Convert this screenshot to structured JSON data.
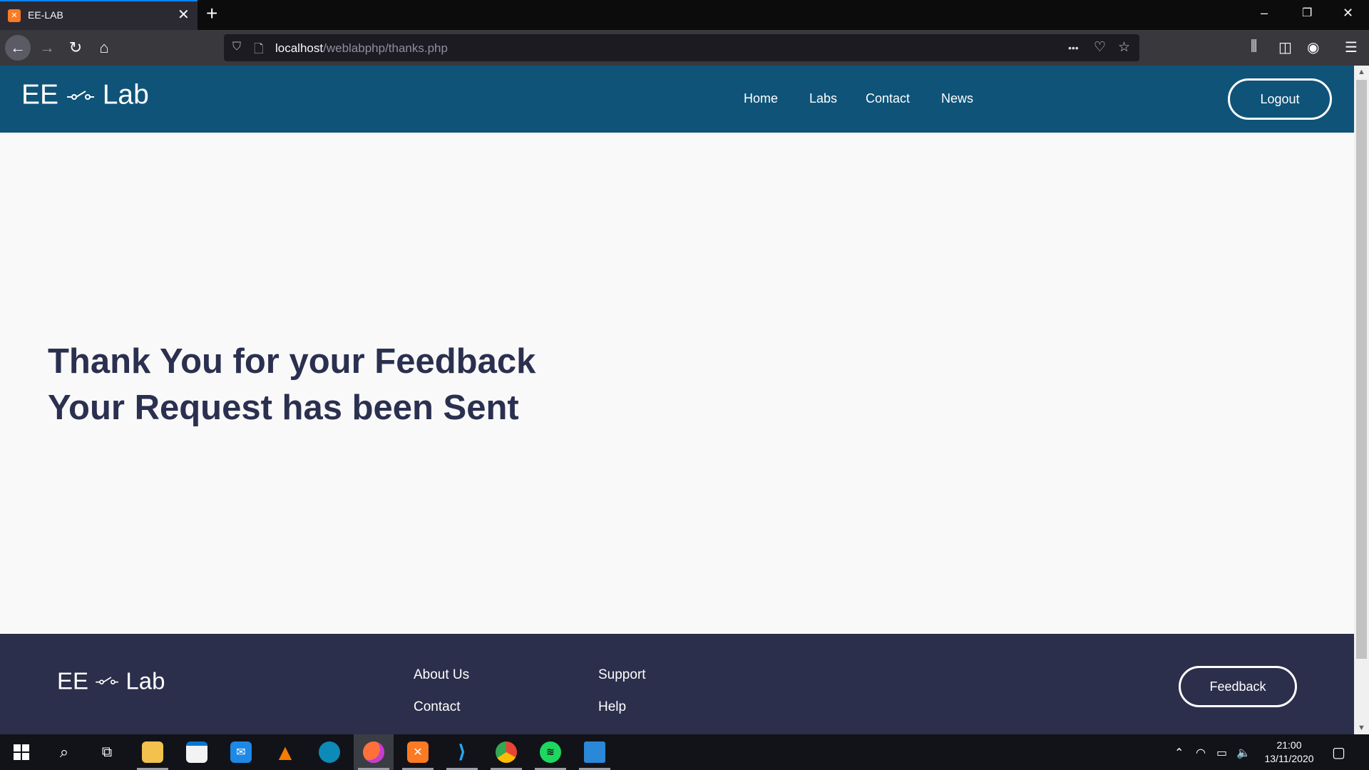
{
  "browser": {
    "tab_title": "EE-LAB",
    "tab_close_glyph": "✕",
    "new_tab_glyph": "+",
    "url_host": "localhost",
    "url_path": "/weblabphp/thanks.php",
    "url_more_glyph": "•••",
    "window_controls": [
      "–",
      "❐",
      "✕"
    ],
    "icons": [
      "back-arrow-icon",
      "forward-arrow-icon",
      "reload-icon",
      "home-icon",
      "shield-icon",
      "page-icon",
      "pocket-icon",
      "bookmark-star-icon",
      "library-icon",
      "sidebar-icon",
      "account-icon",
      "menu-icon"
    ]
  },
  "site": {
    "brand_left": "EE",
    "brand_right": "Lab",
    "nav": [
      "Home",
      "Labs",
      "Contact",
      "News"
    ],
    "logout_label": "Logout",
    "message_line1": "Thank You for your Feedback",
    "message_line2": "Your Request has been Sent",
    "footer_links": [
      "About Us",
      "Contact",
      "Support",
      "Help"
    ],
    "feedback_label": "Feedback",
    "colors": {
      "header_bg": "#0f5379",
      "page_bg": "#f9f9f9",
      "footer_bg": "#2b2f4b",
      "message_text": "#2b3050"
    }
  },
  "taskbar": {
    "apps": [
      "start",
      "search",
      "task-view",
      "file-explorer",
      "microsoft-store",
      "mail",
      "vlc",
      "edge",
      "firefox",
      "xampp",
      "vscode",
      "chrome",
      "spotify",
      "photos"
    ],
    "active_app": "firefox",
    "time": "21:00",
    "date": "13/11/2020"
  }
}
